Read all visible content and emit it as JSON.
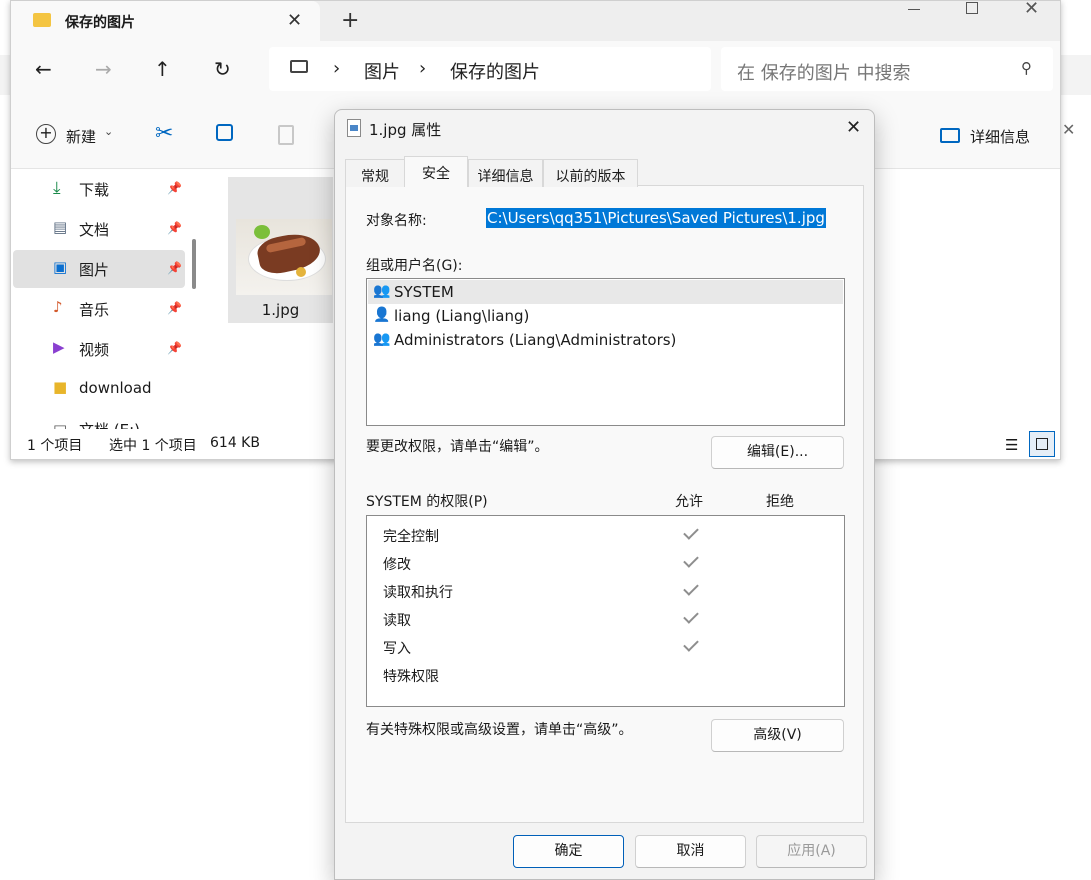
{
  "explorer": {
    "tab_title": "保存的图片",
    "breadcrumb": [
      "图片",
      "保存的图片"
    ],
    "search_placeholder": "在 保存的图片 中搜索",
    "new_label": "新建",
    "details_label": "详细信息",
    "sidebar": [
      {
        "label": "下载",
        "icon": "download-icon"
      },
      {
        "label": "文档",
        "icon": "document-icon"
      },
      {
        "label": "图片",
        "icon": "pictures-icon",
        "selected": true
      },
      {
        "label": "音乐",
        "icon": "music-icon"
      },
      {
        "label": "视频",
        "icon": "video-icon"
      },
      {
        "label": "download",
        "icon": "folder-icon"
      },
      {
        "label": "文档 (E:)",
        "icon": "drive-icon"
      }
    ],
    "file": {
      "name": "1.jpg"
    },
    "status": {
      "count": "1 个项目",
      "selected": "选中 1 个项目",
      "size": "614 KB"
    }
  },
  "dialog": {
    "title": "1.jpg 属性",
    "tabs": [
      "常规",
      "安全",
      "详细信息",
      "以前的版本"
    ],
    "active_tab": "安全",
    "object_name_label": "对象名称:",
    "object_name_value": "C:\\Users\\qq351\\Pictures\\Saved Pictures\\1.jpg",
    "group_label": "组或用户名(G):",
    "users": [
      "SYSTEM",
      "liang (Liang\\liang)",
      "Administrators (Liang\\Administrators)"
    ],
    "change_hint": "要更改权限，请单击“编辑”。",
    "edit_button": "编辑(E)...",
    "perm_label": "SYSTEM 的权限(P)",
    "allow_header": "允许",
    "deny_header": "拒绝",
    "permissions": [
      {
        "name": "完全控制",
        "allow": true
      },
      {
        "name": "修改",
        "allow": true
      },
      {
        "name": "读取和执行",
        "allow": true
      },
      {
        "name": "读取",
        "allow": true
      },
      {
        "name": "写入",
        "allow": true
      },
      {
        "name": "特殊权限",
        "allow": false
      }
    ],
    "advanced_hint": "有关特殊权限或高级设置，请单击“高级”。",
    "advanced_button": "高级(V)",
    "ok_button": "确定",
    "cancel_button": "取消",
    "apply_button": "应用(A)"
  },
  "colors": {
    "accent": "#005fb8",
    "selection": "#0078d7",
    "folder": "#f4c542"
  }
}
